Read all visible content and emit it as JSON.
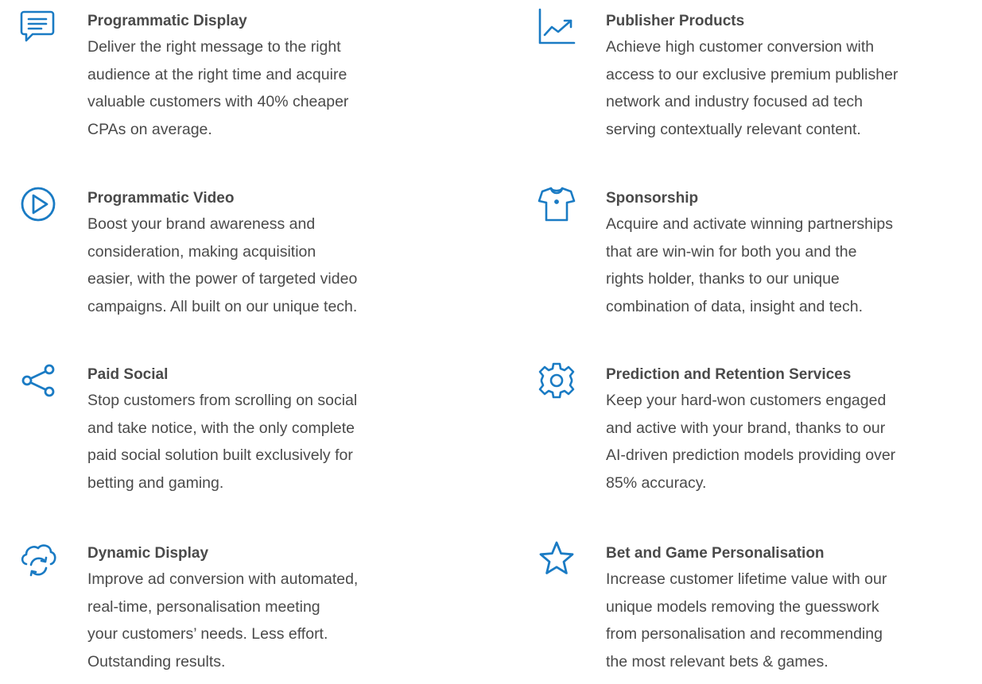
{
  "colors": {
    "accent": "#1a7bc4",
    "text": "#4a4a4a",
    "background": "#ffffff"
  },
  "services": [
    {
      "icon": "chat-bubble-icon",
      "title": "Programmatic Display",
      "description": "Deliver the right message to the right\naudience at the right time and acquire\nvaluable customers with 40% cheaper\nCPAs on average."
    },
    {
      "icon": "trending-up-chart-icon",
      "title": "Publisher Products",
      "description": "Achieve high customer conversion with\naccess to our exclusive premium publisher\nnetwork and industry focused ad tech\nserving contextually relevant content."
    },
    {
      "icon": "play-circle-icon",
      "title": "Programmatic Video",
      "description": "Boost your brand awareness and\nconsideration, making acquisition\neasier, with the power of targeted video\ncampaigns. All built on our unique tech."
    },
    {
      "icon": "sports-shirt-icon",
      "title": "Sponsorship",
      "description": "Acquire and activate winning partnerships\nthat are win-win for both you and the\nrights holder, thanks to our unique\ncombination of data, insight and tech."
    },
    {
      "icon": "share-icon",
      "title": "Paid Social",
      "description": "Stop customers from scrolling on social\nand take notice, with the only complete\npaid social solution built exclusively for\nbetting and gaming."
    },
    {
      "icon": "gear-icon",
      "title": "Prediction and Retention Services",
      "description": "Keep your hard-won customers engaged\nand active with your brand, thanks to our\nAI-driven prediction models providing over\n85% accuracy."
    },
    {
      "icon": "cloud-sync-icon",
      "title": "Dynamic Display",
      "description": "Improve ad conversion with automated,\nreal-time, personalisation meeting\nyour customers’ needs. Less effort.\nOutstanding results."
    },
    {
      "icon": "star-icon",
      "title": "Bet and Game Personalisation",
      "description": "Increase customer lifetime value with our\nunique models removing the guesswork\nfrom personalisation and recommending\nthe most relevant bets & games."
    }
  ]
}
